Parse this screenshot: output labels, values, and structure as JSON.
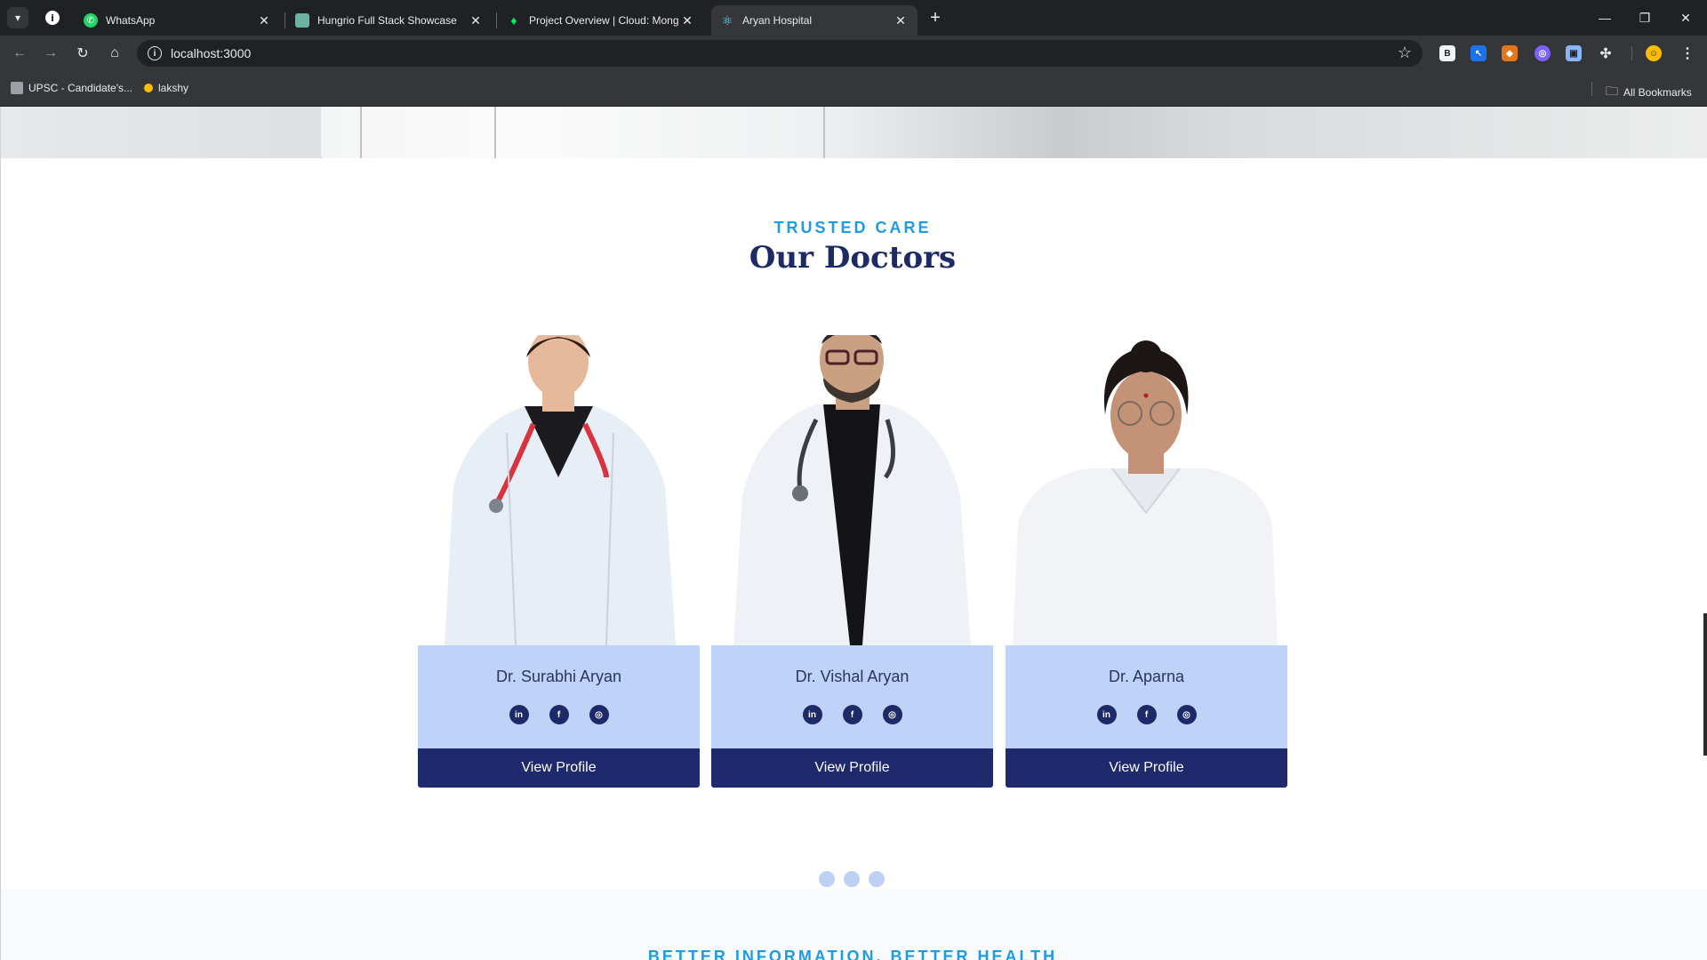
{
  "browser": {
    "tabs": [
      {
        "title": "WhatsApp",
        "icon": "whatsapp-icon",
        "color": "#25d366"
      },
      {
        "title": "Hungrio Full Stack Showcase",
        "icon": "page-icon",
        "color": "#6bb3a5"
      },
      {
        "title": "Project Overview | Cloud: Mong",
        "icon": "mongodb-leaf-icon",
        "color": "#00ed64"
      },
      {
        "title": "Aryan Hospital",
        "icon": "react-icon",
        "color": "#61dafb"
      }
    ],
    "active_tab_index": 3,
    "url": "localhost:3000",
    "bookmarks": [
      {
        "label": "UPSC - Candidate's...",
        "icon": "upsc-icon"
      },
      {
        "label": "lakshy",
        "icon": "lakshy-icon"
      }
    ],
    "all_bookmarks_label": "All Bookmarks"
  },
  "doctors_section": {
    "eyebrow": "TRUSTED CARE",
    "title": "Our Doctors",
    "cta_label": "View Profile",
    "doctors": [
      {
        "name": "Dr. Surabhi Aryan",
        "socials": [
          "in",
          "f",
          "ig"
        ]
      },
      {
        "name": "Dr. Vishal Aryan",
        "socials": [
          "in",
          "f",
          "ig"
        ]
      },
      {
        "name": "Dr. Aparna",
        "socials": [
          "in",
          "f",
          "ig"
        ]
      }
    ],
    "carousel_dots": 3
  },
  "next_section": {
    "eyebrow": "BETTER INFORMATION, BETTER HEALTH"
  },
  "colors": {
    "accent": "#1e9be2",
    "navy": "#1e2a6b",
    "card_info_bg": "#bfd2f7"
  }
}
